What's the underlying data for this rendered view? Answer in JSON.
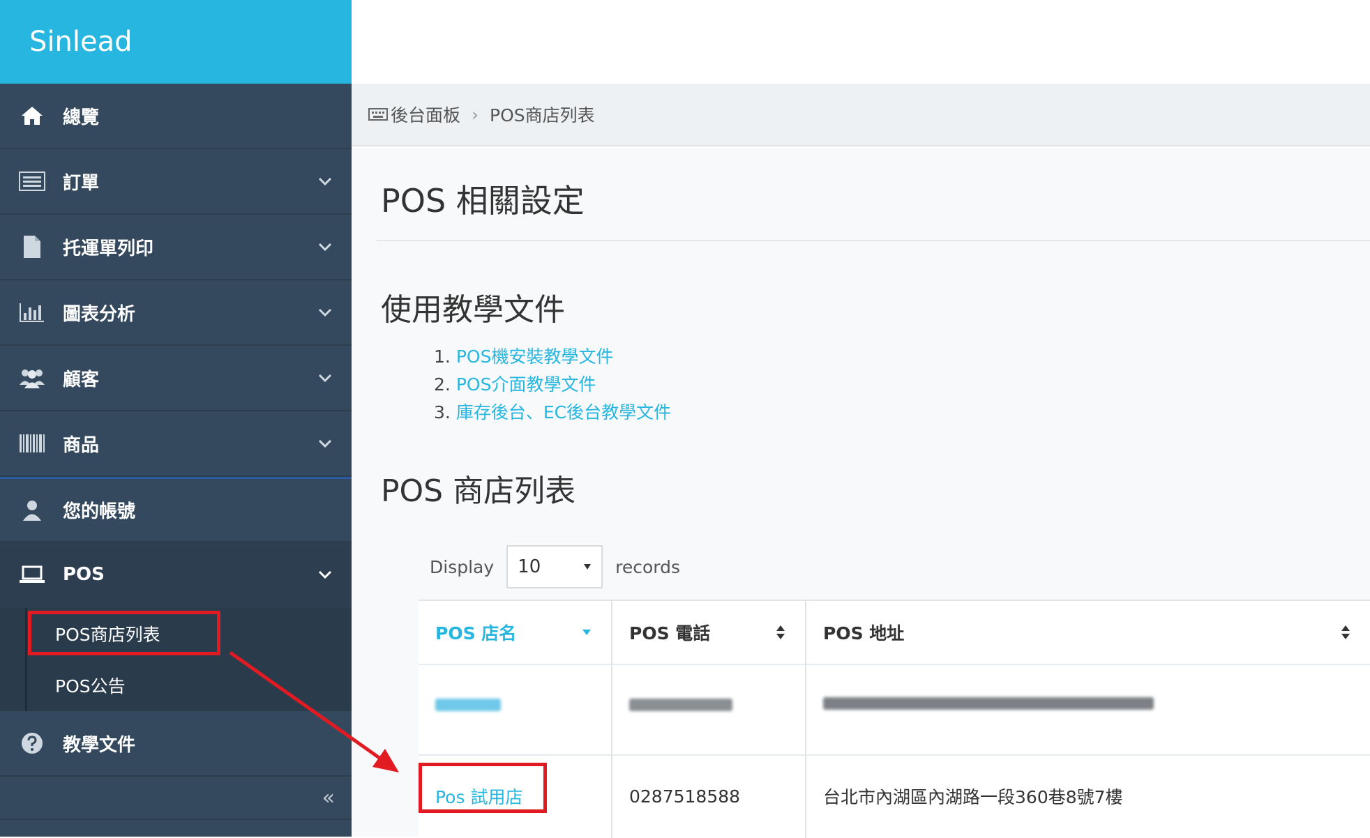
{
  "brand": "Sinlead",
  "colors": {
    "accent": "#27b6e0",
    "sidebar": "#34495e",
    "highlight": "#e21b23"
  },
  "sidebar": {
    "items": [
      {
        "label": "總覽",
        "icon": "home-icon",
        "has_chevron": false
      },
      {
        "label": "訂單",
        "icon": "list-icon",
        "has_chevron": true
      },
      {
        "label": "托運單列印",
        "icon": "file-icon",
        "has_chevron": true
      },
      {
        "label": "圖表分析",
        "icon": "bar-chart-icon",
        "has_chevron": true
      },
      {
        "label": "顧客",
        "icon": "users-icon",
        "has_chevron": true
      },
      {
        "label": "商品",
        "icon": "barcode-icon",
        "has_chevron": true
      },
      {
        "label": "您的帳號",
        "icon": "user-icon",
        "has_chevron": false
      },
      {
        "label": "POS",
        "icon": "laptop-icon",
        "has_chevron": true,
        "expanded": true
      }
    ],
    "pos_subitems": [
      "POS商店列表",
      "POS公告"
    ],
    "docs_item": {
      "label": "教學文件",
      "icon": "question-circle-icon"
    },
    "collapse": "«"
  },
  "breadcrumb": {
    "root": "後台面板",
    "current": "POS商店列表"
  },
  "main": {
    "title": "POS 相關設定",
    "docs_section": {
      "title": "使用教學文件",
      "links": [
        {
          "num": "1.",
          "label": "POS機安裝教學文件"
        },
        {
          "num": "2.",
          "label": "POS介面教學文件"
        },
        {
          "num": "3.",
          "label": "庫存後台、EC後台教學文件"
        }
      ]
    },
    "store_section": {
      "title": "POS 商店列表"
    },
    "display": {
      "prefix": "Display",
      "value": "10",
      "suffix": "records"
    },
    "table": {
      "headers": [
        "POS 店名",
        "POS 電話",
        "POS 地址"
      ],
      "rows": [
        {
          "name": "Pos 試用店",
          "phone": "0287518588",
          "address": "台北市內湖區內湖路一段360巷8號7樓"
        }
      ]
    }
  }
}
